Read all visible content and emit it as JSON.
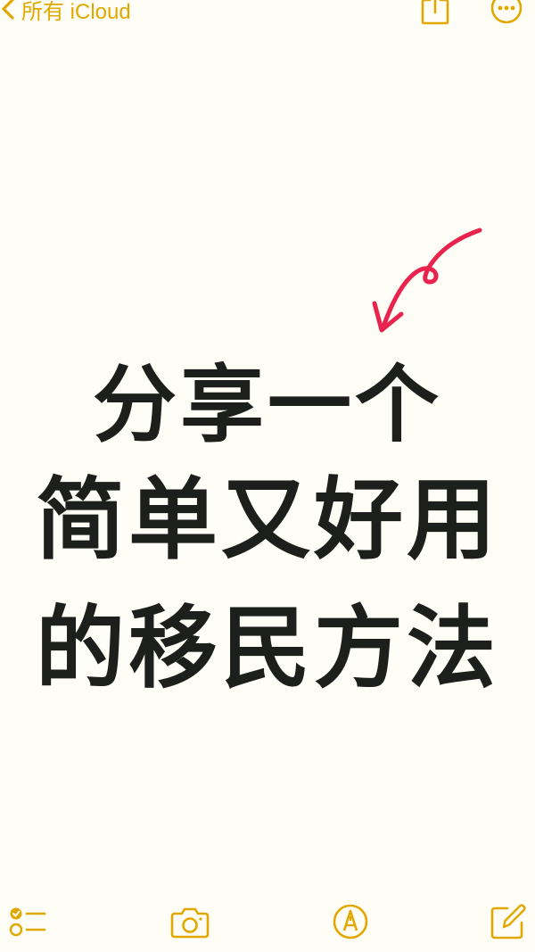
{
  "nav": {
    "back_label": "所有 iCloud"
  },
  "note": {
    "lines": [
      "分享一个",
      "简单又好用",
      "的移民方法"
    ]
  },
  "colors": {
    "accent": "#e0a800",
    "ink": "#1c1f1c",
    "arrow": "#e8244e",
    "paper": "#fffef6"
  },
  "icons": {
    "back": "chevron-left-icon",
    "share": "share-icon",
    "more": "more-icon",
    "checklist": "checklist-icon",
    "camera": "camera-icon",
    "markup": "markup-icon",
    "compose": "compose-icon"
  }
}
